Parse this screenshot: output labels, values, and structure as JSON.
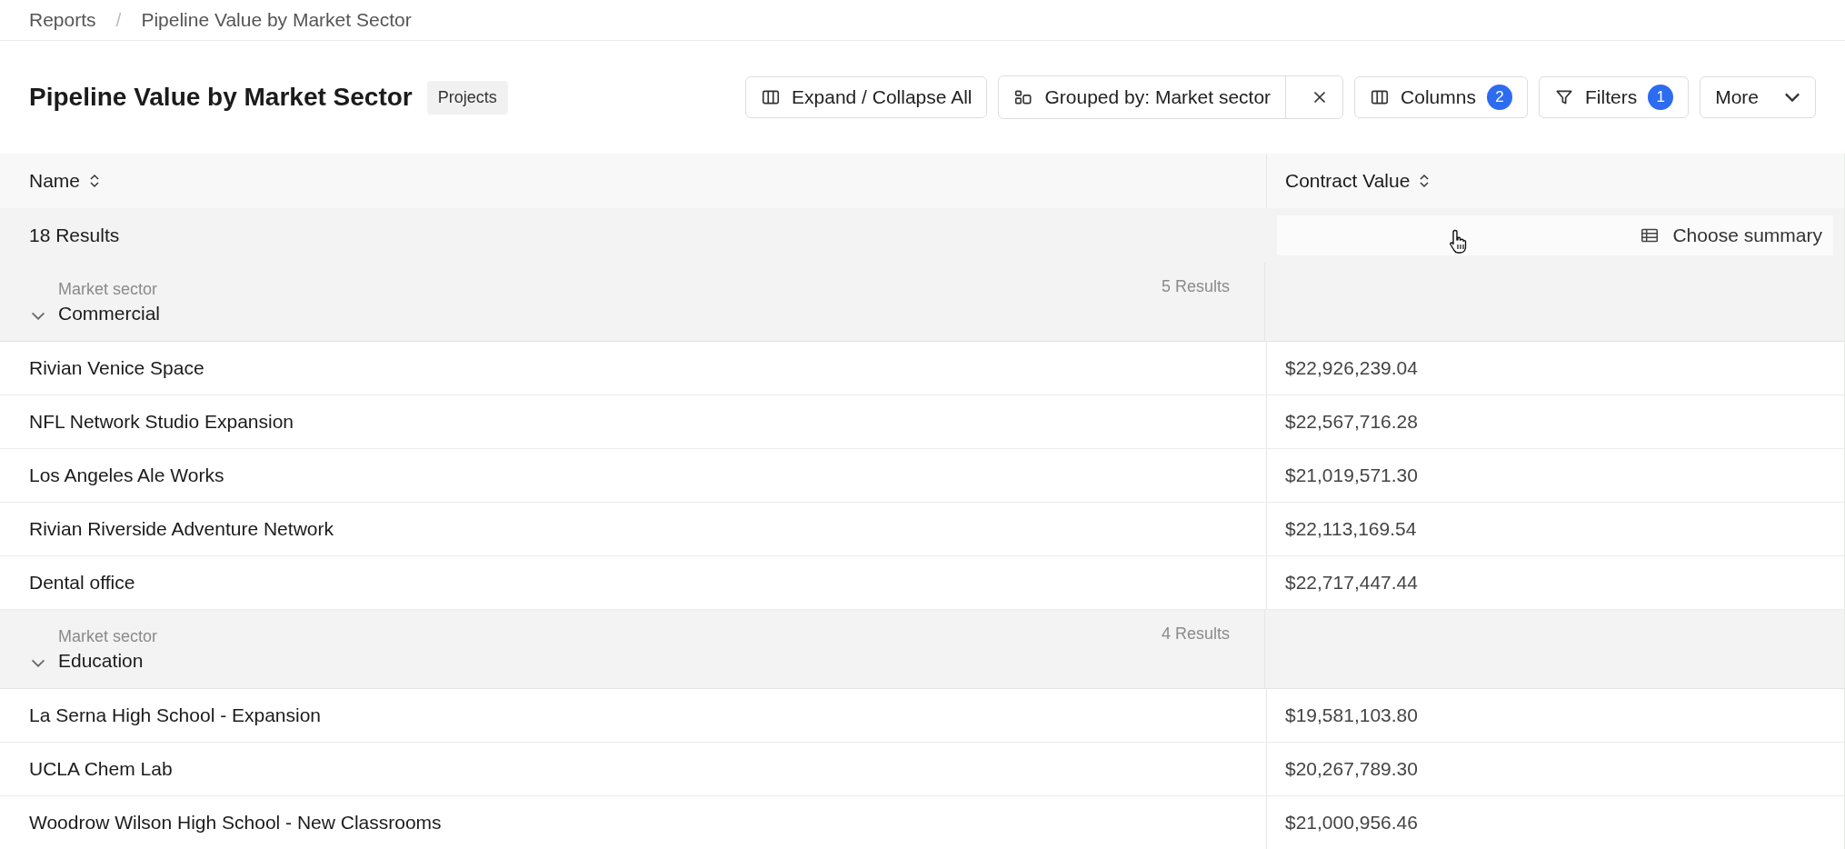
{
  "breadcrumb": [
    "Reports",
    "Pipeline Value by Market Sector"
  ],
  "breadcrumb_separator": "/",
  "title": "Pipeline Value by Market Sector",
  "tag": "Projects",
  "toolbar": {
    "expand_collapse": "Expand / Collapse All",
    "grouped_by": "Grouped by: Market sector",
    "columns": {
      "label": "Columns",
      "count": "2"
    },
    "filters": {
      "label": "Filters",
      "count": "1"
    },
    "more": "More"
  },
  "table": {
    "columns": [
      "Name",
      "Contract Value"
    ],
    "results": "18 Results",
    "summary": "Choose summary",
    "groups": [
      {
        "label": "Market sector",
        "name": "Commercial",
        "count": "5 Results",
        "expanded": true,
        "rows": [
          {
            "name": "Rivian Venice Space",
            "value": "$22,926,239.04"
          },
          {
            "name": "NFL Network Studio Expansion",
            "value": "$22,567,716.28"
          },
          {
            "name": "Los Angeles Ale Works",
            "value": "$21,019,571.30"
          },
          {
            "name": "Rivian Riverside Adventure Network",
            "value": "$22,113,169.54"
          },
          {
            "name": "Dental office",
            "value": "$22,717,447.44"
          }
        ]
      },
      {
        "label": "Market sector",
        "name": "Education",
        "count": "4 Results",
        "expanded": true,
        "rows": [
          {
            "name": "La Serna High School - Expansion",
            "value": "$19,581,103.80"
          },
          {
            "name": "UCLA Chem Lab",
            "value": "$20,267,789.30"
          },
          {
            "name": "Woodrow Wilson High School - New Classrooms",
            "value": "$21,000,956.46"
          }
        ]
      }
    ]
  }
}
